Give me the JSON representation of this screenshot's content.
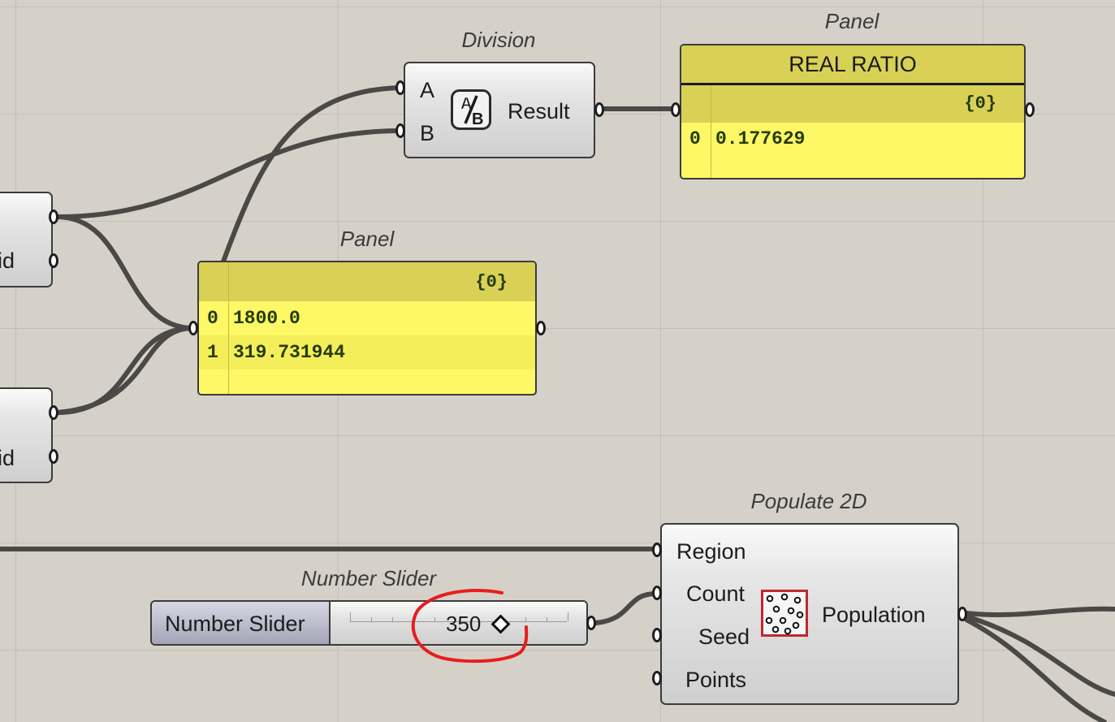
{
  "division": {
    "title": "Division",
    "input_a": "A",
    "input_b": "B",
    "output": "Result",
    "icon": "division-icon"
  },
  "ratio_panel": {
    "title": "Panel",
    "header": "REAL RATIO",
    "path": "{0}",
    "rows": [
      {
        "index": "0",
        "value": "0.177629"
      }
    ]
  },
  "values_panel": {
    "title": "Panel",
    "path": "{0}",
    "rows": [
      {
        "index": "0",
        "value": "1800.0"
      },
      {
        "index": "1",
        "value": "319.731944"
      }
    ]
  },
  "left_nodes": [
    {
      "label_fragment": "oid"
    },
    {
      "label_fragment": "oid"
    }
  ],
  "number_slider": {
    "title": "Number Slider",
    "name": "Number Slider",
    "value": "350",
    "annotation_color": "#e61e1e"
  },
  "populate": {
    "title": "Populate 2D",
    "inputs": [
      "Region",
      "Count",
      "Seed",
      "Points"
    ],
    "output": "Population",
    "icon": "populate-points-icon",
    "icon_accent": "#c0282d"
  },
  "colors": {
    "canvas": "#d5d1c9",
    "wire": "#4a4844",
    "panel_yellow": "#fdf865",
    "panel_text": "#253c08"
  }
}
